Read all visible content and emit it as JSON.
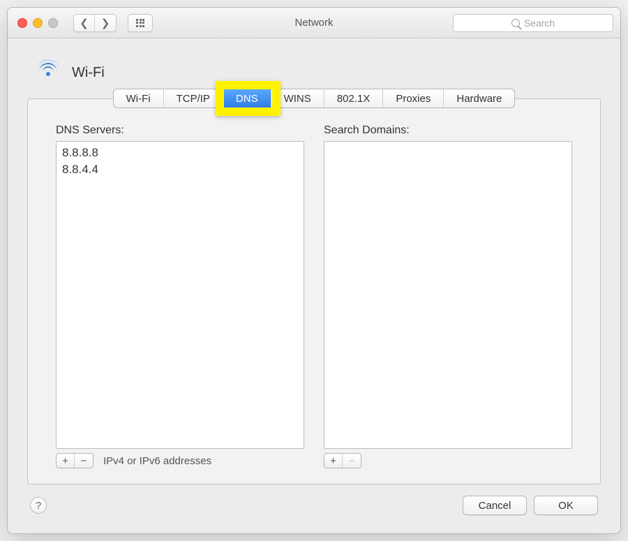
{
  "window": {
    "title": "Network"
  },
  "search": {
    "placeholder": "Search"
  },
  "header": {
    "title": "Wi-Fi"
  },
  "tabs": [
    {
      "label": "Wi-Fi",
      "active": false
    },
    {
      "label": "TCP/IP",
      "active": false
    },
    {
      "label": "DNS",
      "active": true
    },
    {
      "label": "WINS",
      "active": false
    },
    {
      "label": "802.1X",
      "active": false
    },
    {
      "label": "Proxies",
      "active": false
    },
    {
      "label": "Hardware",
      "active": false
    }
  ],
  "dns": {
    "servers_label": "DNS Servers:",
    "servers": [
      "8.8.8.8",
      "8.8.4.4"
    ],
    "search_domains_label": "Search Domains:",
    "search_domains": [],
    "hint": "IPv4 or IPv6 addresses"
  },
  "buttons": {
    "add": "+",
    "remove": "−",
    "cancel": "Cancel",
    "ok": "OK",
    "help": "?"
  },
  "highlight": {
    "target_tab_index": 2
  }
}
